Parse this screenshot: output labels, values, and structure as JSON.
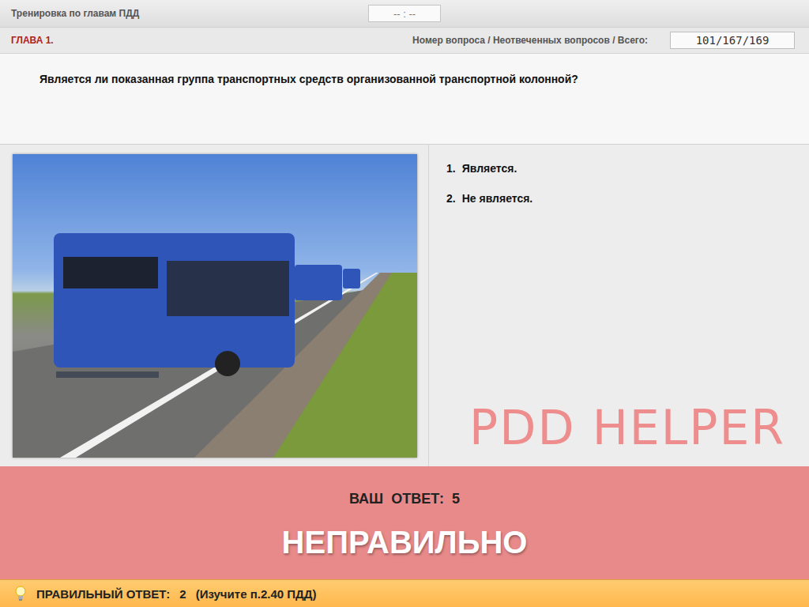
{
  "header": {
    "title": "Тренировка по главам ПДД",
    "timer": "-- : --"
  },
  "chapter": {
    "label": "ГЛАВА 1.",
    "counter_label": "Номер вопроса / Неотвеченных вопросов / Всего:",
    "counter": "101/167/169"
  },
  "question": {
    "text": "Является ли показанная группа транспортных средств организованной транспортной колонной?"
  },
  "answers": [
    {
      "number": "1.",
      "text": "Является."
    },
    {
      "number": "2.",
      "text": "Не является."
    }
  ],
  "watermark": "PDD HELPER",
  "result": {
    "your_answer_label": "ВАШ  ОТВЕТ:",
    "your_answer": "5",
    "verdict": "НЕПРАВИЛЬНО",
    "correct": false
  },
  "hint": {
    "label": "ПРАВИЛЬНЫЙ ОТВЕТ:",
    "answer": "2",
    "reference": "(Изучите п.2.40 ПДД)"
  }
}
